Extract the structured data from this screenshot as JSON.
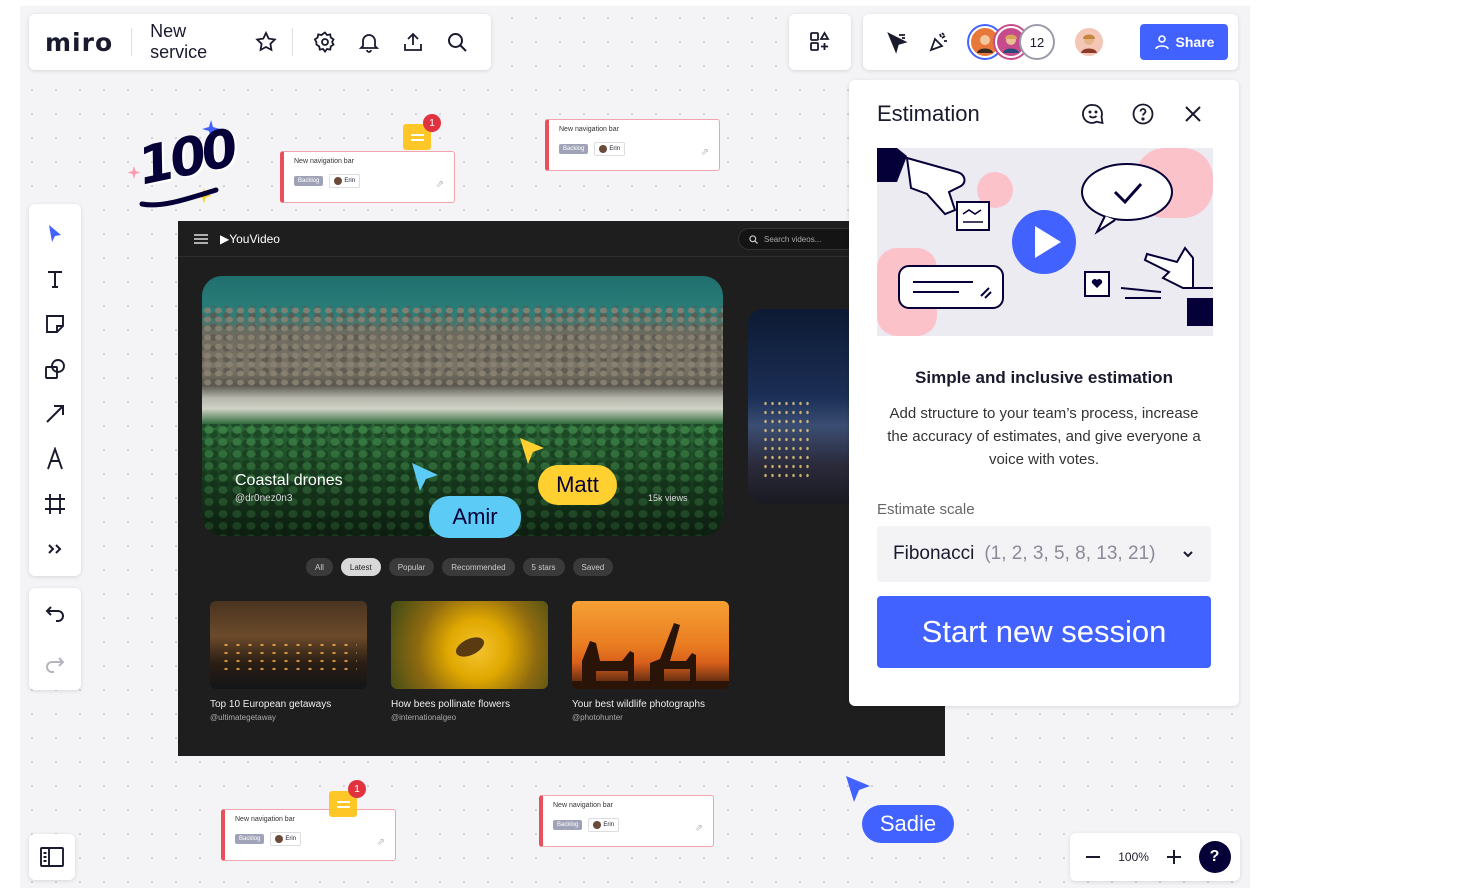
{
  "app": {
    "logo": "miro",
    "board_name": "New service"
  },
  "topbar": {
    "icons": [
      "star-icon",
      "gear-icon",
      "bell-icon",
      "upload-icon",
      "search-icon"
    ]
  },
  "collaborators": {
    "count_label": "12",
    "share_label": "Share"
  },
  "toolbar": {
    "tools": [
      "select-icon",
      "text-icon",
      "sticky-note-icon",
      "shapes-icon",
      "arrow-icon",
      "pen-icon",
      "frame-icon",
      "more-icon"
    ]
  },
  "sticker": {
    "text": "100"
  },
  "cards": [
    {
      "title": "New navigation bar",
      "tag": "Backlog",
      "user": "Erin"
    },
    {
      "title": "New navigation bar",
      "tag": "Backlog",
      "user": "Erin"
    },
    {
      "title": "New navigation bar",
      "tag": "Backlog",
      "user": "Erin"
    },
    {
      "title": "New navigation bar",
      "tag": "Backlog",
      "user": "Erin"
    }
  ],
  "comment_badges": [
    "1",
    "1"
  ],
  "youvideo": {
    "logo": "YouVideo",
    "search_placeholder": "Search videos...",
    "hero": {
      "title": "Coastal drones",
      "handle": "@dr0nez0n3",
      "views": "15k views"
    },
    "chips": [
      "All",
      "Latest",
      "Popular",
      "Recommended",
      "5 stars",
      "Saved"
    ],
    "active_chip": "Latest",
    "videos": [
      {
        "title": "Top 10 European getaways",
        "channel": "@ultimategetaway"
      },
      {
        "title": "How bees pollinate flowers",
        "channel": "@internationalgeo"
      },
      {
        "title": "Your best wildlife photographs",
        "channel": "@photohunter"
      }
    ]
  },
  "cursors": [
    {
      "name": "Amir",
      "color": "#5ccbf5"
    },
    {
      "name": "Matt",
      "color": "#ffd02f"
    },
    {
      "name": "Sadie",
      "color": "#4262ff"
    }
  ],
  "estimation": {
    "title": "Estimation",
    "subtitle": "Simple and inclusive estimation",
    "description": "Add structure to your team’s process, increase the accuracy of estimates, and give everyone a voice with votes.",
    "scale_label": "Estimate scale",
    "scale_value": "Fibonacci",
    "scale_range": "(1, 2, 3, 5, 8, 13, 21)",
    "start_label": "Start new session"
  },
  "zoom": {
    "level": "100%",
    "help": "?"
  },
  "colors": {
    "accent": "#4262ff",
    "card_border": "#e8505b",
    "comment": "#ffc627"
  }
}
